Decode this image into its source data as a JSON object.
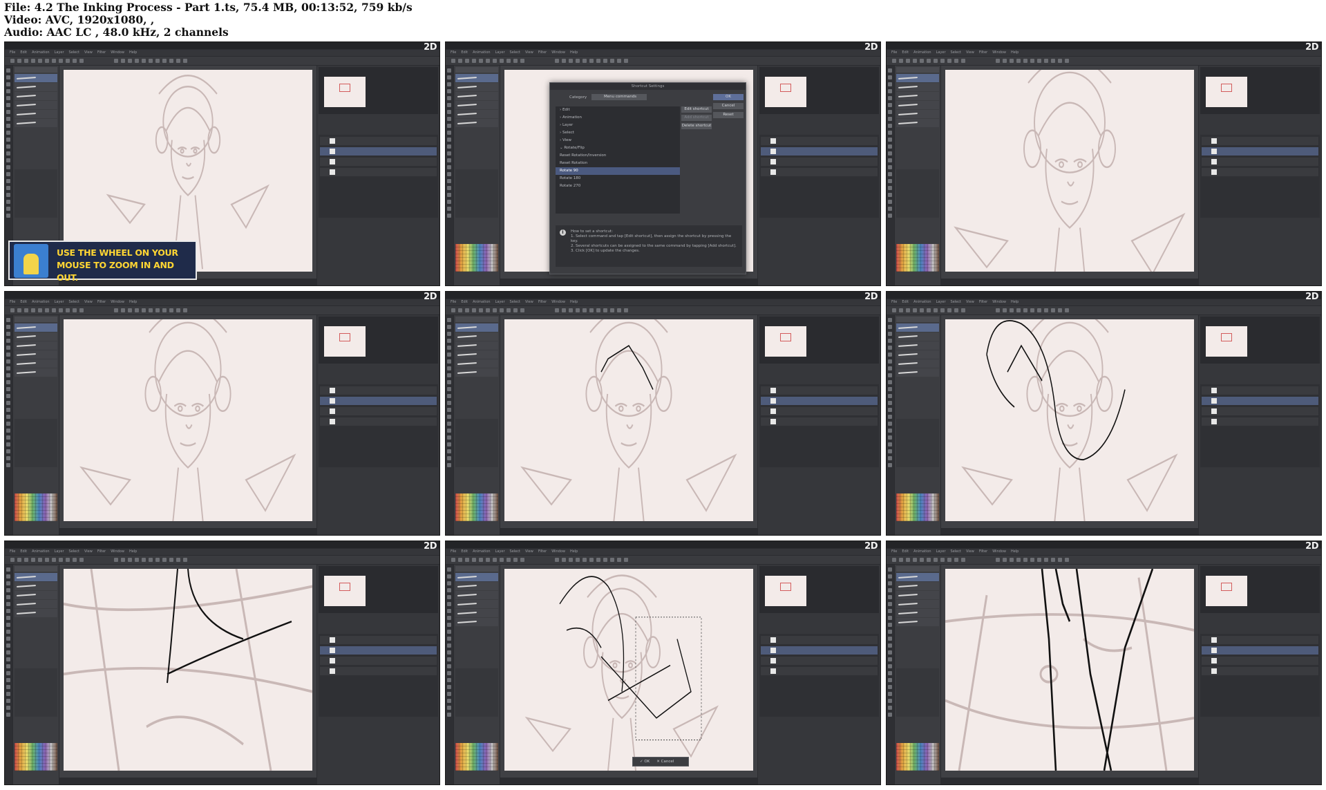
{
  "header": {
    "line1": "File: 4.2 The Inking Process - Part 1.ts, 75.4 MB, 00:13:52, 759 kb/s",
    "line2": "Video: AVC, 1920x1080, ,",
    "line3": "Audio: AAC LC , 48.0 kHz, 2 channels"
  },
  "app": {
    "brand": "2D",
    "menus": [
      "File",
      "Edit",
      "Animation",
      "Layer",
      "Select",
      "View",
      "Filter",
      "Window",
      "Help"
    ]
  },
  "tiles": [
    {
      "id": "t1",
      "brushes": [
        "G-pen",
        "Real G-Pen",
        "Mapping pen",
        "Turnip pen",
        "Calligraphy",
        "Textured pen"
      ],
      "layers": [
        "100 % Normal",
        "20 % Normal sketch",
        "Paper"
      ],
      "banner": "USE THE WHEEL ON YOUR MOUSE TO ZOOM IN AND OUT."
    },
    {
      "id": "t2",
      "dialog": {
        "title": "Shortcut Settings",
        "category_label": "Category",
        "category_value": "Menu commands",
        "items": [
          "Edit",
          "Animation",
          "Layer",
          "Select",
          "View",
          "Rotate/Flip",
          "Reset Rotation/Inversion",
          "Reset Rotation",
          "Rotate 90",
          "Rotate 180",
          "Rotate 270"
        ],
        "selected_index": 8,
        "buttons": {
          "ok": "OK",
          "cancel": "Cancel",
          "edit": "Edit shortcut",
          "add": "Add shortcut",
          "delete": "Delete shortcut",
          "reset": "Reset"
        },
        "help": [
          "How to set a shortcut:",
          "1. Select command and tap [Edit shortcut], then assign the shortcut by pressing the key.",
          "2. Several shortcuts can be assigned to the same command by tapping [Add shortcut].",
          "3. Click [OK] to update the changes."
        ]
      }
    },
    {
      "id": "t3"
    },
    {
      "id": "t4"
    },
    {
      "id": "t5"
    },
    {
      "id": "t6"
    },
    {
      "id": "t7",
      "brushes": [
        "Eraser",
        "Hard",
        "Soft",
        "Rough",
        "Vector"
      ]
    },
    {
      "id": "t8",
      "brushes": [
        "Selection area",
        "Rectangle",
        "Ellipse",
        "Lasso",
        "Polyline",
        "Shrink selection"
      ],
      "ok": "OK",
      "cancel": "Cancel"
    },
    {
      "id": "t9"
    }
  ]
}
